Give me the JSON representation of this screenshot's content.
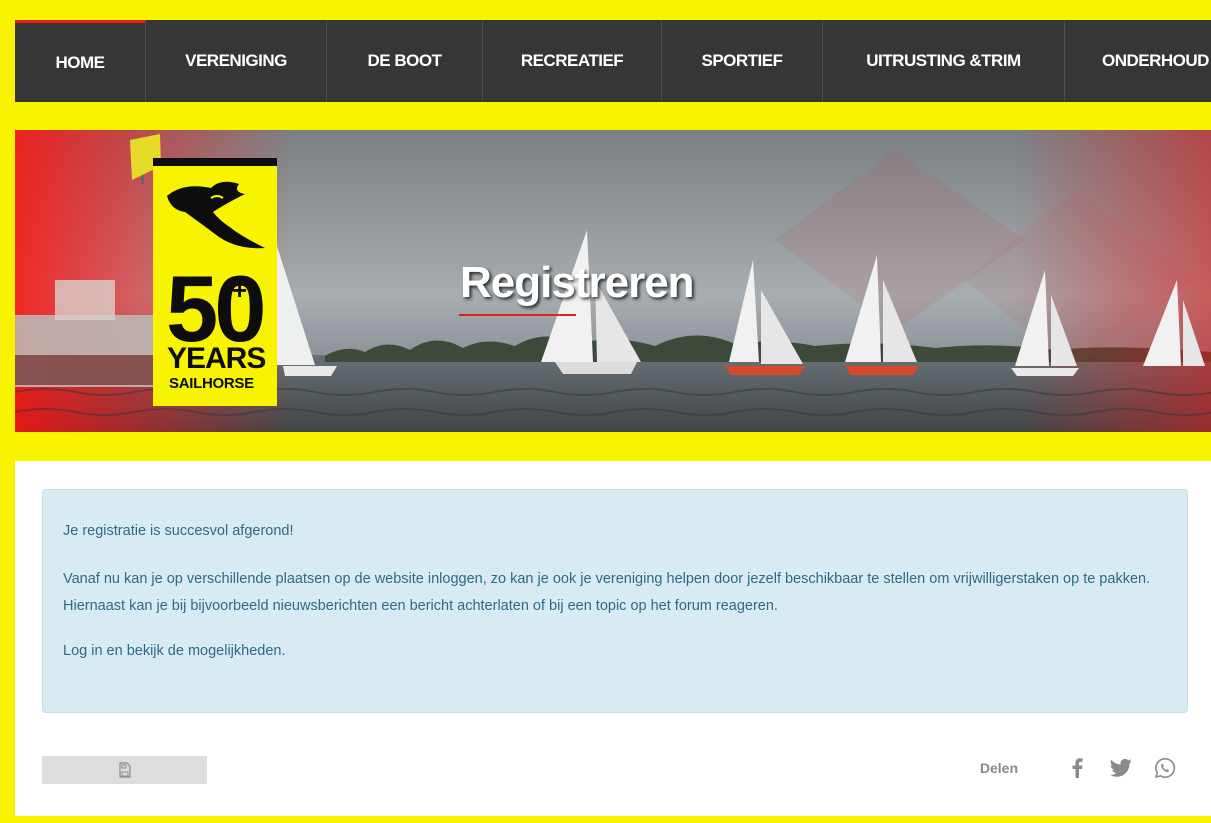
{
  "nav": {
    "items": [
      {
        "label": "HOME",
        "active": true
      },
      {
        "label": "VERENIGING"
      },
      {
        "label": "DE BOOT"
      },
      {
        "label": "RECREATIEF"
      },
      {
        "label": "SPORTIEF"
      },
      {
        "label": "UITRUSTING &TRIM"
      },
      {
        "label": "ONDERHOUD"
      }
    ]
  },
  "hero": {
    "title": "Registreren",
    "logo": {
      "number": "50",
      "plus": "+",
      "years": "YEARS",
      "brand": "SAILHORSE"
    }
  },
  "alert": {
    "line1": "Je registratie is succesvol afgerond!",
    "line2": "Vanaf nu kan je op verschillende plaatsen op de website inloggen, zo kan je ook je vereniging helpen door jezelf beschikbaar te stellen om vrijwilligerstaken op te pakken. Hiernaast kan je bij bijvoorbeeld nieuwsberichten een bericht achterlaten of bij een topic op het forum reageren.",
    "line3": "Log in en bekijk de mogelijkheden."
  },
  "share": {
    "label": "Delen"
  },
  "icons": {
    "print": "print-icon",
    "facebook": "facebook-icon",
    "twitter": "twitter-icon",
    "whatsapp": "whatsapp-icon"
  },
  "colors": {
    "background": "#f8f400",
    "nav": "#363636",
    "accent": "#e3201b",
    "alert_bg": "#d8ebf3",
    "alert_text": "#2f6a84"
  }
}
